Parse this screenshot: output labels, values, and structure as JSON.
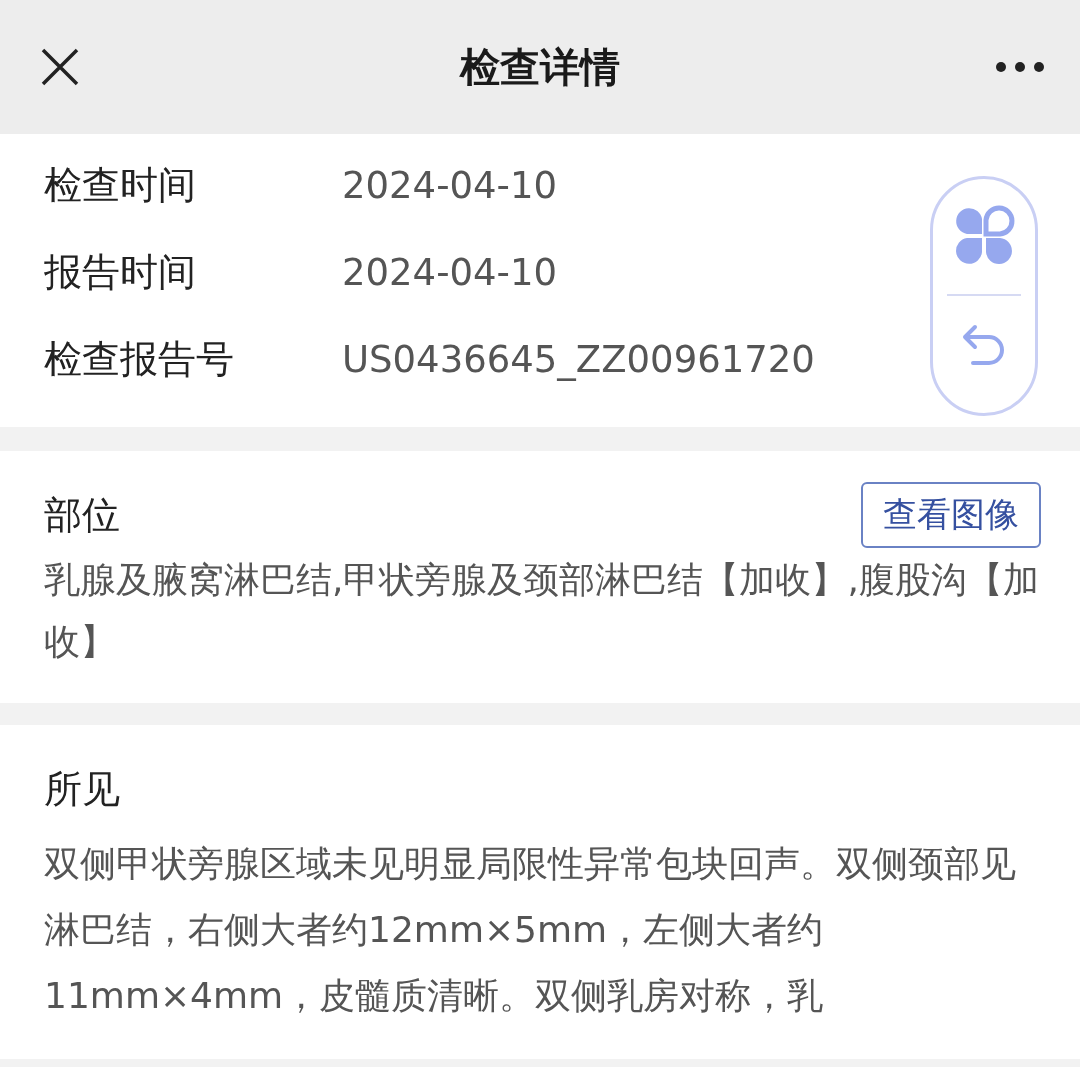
{
  "header": {
    "title": "检查详情"
  },
  "info": [
    {
      "label": "检查时间",
      "value": "2024-04-10"
    },
    {
      "label": "报告时间",
      "value": "2024-04-10"
    },
    {
      "label": "检查报告号",
      "value": "US0436645_ZZ00961720"
    }
  ],
  "site": {
    "title": "部位",
    "button": "查看图像",
    "text": "乳腺及腋窝淋巴结,甲状旁腺及颈部淋巴结【加收】,腹股沟【加收】"
  },
  "findings": {
    "title": "所见",
    "text": "双侧甲状旁腺区域未见明显局限性异常包块回声。双侧颈部见淋巴结，右侧大者约12mm×5mm，左侧大者约11mm×4mm，皮髓质清晰。双侧乳房对称，乳"
  }
}
